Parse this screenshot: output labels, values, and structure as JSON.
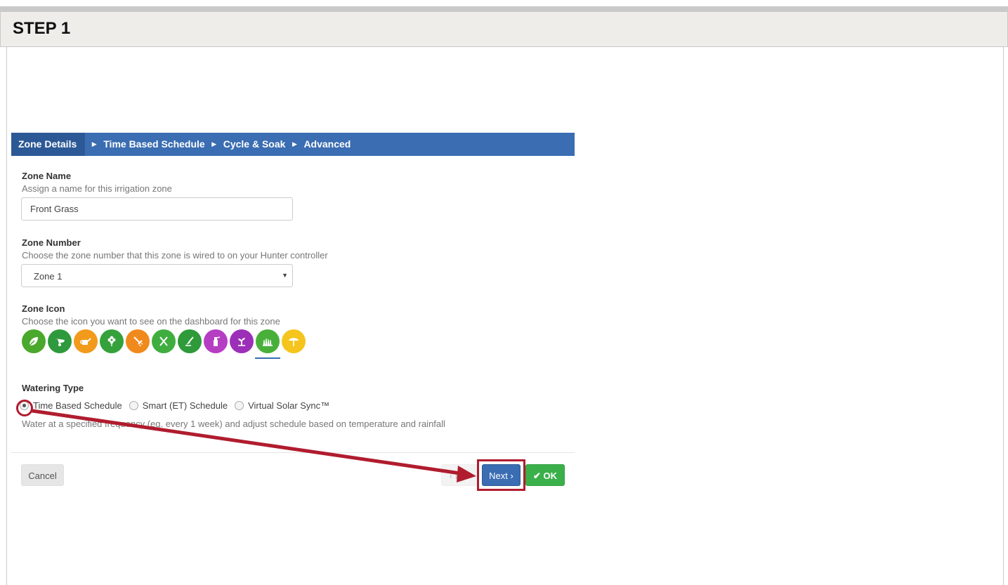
{
  "header": {
    "step_title": "STEP 1"
  },
  "wizard_nav": {
    "tabs": [
      {
        "label": "Zone Details",
        "active": true
      },
      {
        "label": "Time Based Schedule",
        "active": false
      },
      {
        "label": "Cycle & Soak",
        "active": false
      },
      {
        "label": "Advanced",
        "active": false
      }
    ]
  },
  "zone_name": {
    "label": "Zone Name",
    "help": "Assign a name for this irrigation zone",
    "value": "Front Grass"
  },
  "zone_number": {
    "label": "Zone Number",
    "help": "Choose the zone number that this zone is wired to on your Hunter controller",
    "selected": "Zone 1"
  },
  "zone_icon": {
    "label": "Zone Icon",
    "help": "Choose the icon you want to see on the dashboard for this zone",
    "icons": [
      {
        "name": "leaf-icon",
        "color": "#4aa82c"
      },
      {
        "name": "wheelbarrow-icon",
        "color": "#2f9a3d"
      },
      {
        "name": "watering-can-icon",
        "color": "#f29a1b"
      },
      {
        "name": "flower-icon",
        "color": "#35a13a"
      },
      {
        "name": "rake-icon",
        "color": "#f08a1c"
      },
      {
        "name": "shears-icon",
        "color": "#3fae3f"
      },
      {
        "name": "shovel-icon",
        "color": "#2e9a3a"
      },
      {
        "name": "sprayer-icon",
        "color": "#b63ec3"
      },
      {
        "name": "sprout-icon",
        "color": "#9c2fb8"
      },
      {
        "name": "grass-icon",
        "color": "#48b03a",
        "selected": true
      },
      {
        "name": "tree-icon",
        "color": "#f5c51d"
      }
    ]
  },
  "watering_type": {
    "label": "Watering Type",
    "options": [
      {
        "label": "Time Based Schedule",
        "checked": true
      },
      {
        "label": "Smart (ET) Schedule",
        "checked": false
      },
      {
        "label": "Virtual Solar Sync™",
        "checked": false
      }
    ],
    "description": "Water at a specified frequency (eg. every 1 week) and adjust schedule based on temperature and rainfall"
  },
  "buttons": {
    "cancel": "Cancel",
    "prev": "‹ Pre",
    "next": "Next ›",
    "ok": "✔ OK"
  },
  "colors": {
    "nav_bar": "#3a6db2",
    "annotation": "#b01c2e",
    "ok_green": "#3bb04a"
  }
}
